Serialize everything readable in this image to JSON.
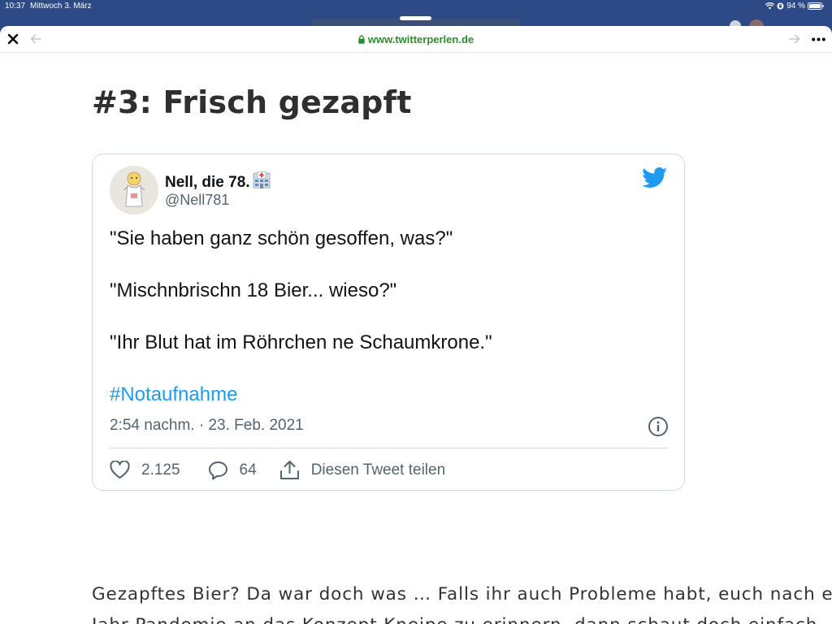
{
  "status_bar": {
    "time": "10:37",
    "date": "Mittwoch 3. März",
    "battery": "94 %"
  },
  "browser": {
    "url": "www.twitterperlen.de",
    "lock_icon": "lock-icon",
    "close_icon": "close-icon",
    "back_icon": "arrow-left-icon",
    "forward_icon": "arrow-right-icon",
    "more_icon": "more-horizontal-icon"
  },
  "article": {
    "heading": "#3: Frisch gezapft",
    "body_lines": [
      "Gezapftes Bier? Da war doch was … Falls ihr auch Probleme habt, euch nach einem",
      "Jahr Pandemie an das Konzept Kneipe zu erinnern, dann schaut doch einfach"
    ]
  },
  "tweet": {
    "author_name": "Nell, die 78.",
    "author_handle": "@Nell781",
    "lines": [
      "\"Sie haben ganz schön gesoffen, was?\"",
      "\"Mischnbrischn 18 Bier... wieso?\"",
      "\"Ihr Blut hat im Röhrchen ne Schaumkrone.\""
    ],
    "hashtag": "#Notaufnahme",
    "timestamp": "2:54 nachm. · 23. Feb. 2021",
    "likes": "2.125",
    "replies": "64",
    "share_label": "Diesen Tweet teilen",
    "colors": {
      "link": "#1d9bf0",
      "text": "#0f1419",
      "muted": "#536471"
    }
  }
}
